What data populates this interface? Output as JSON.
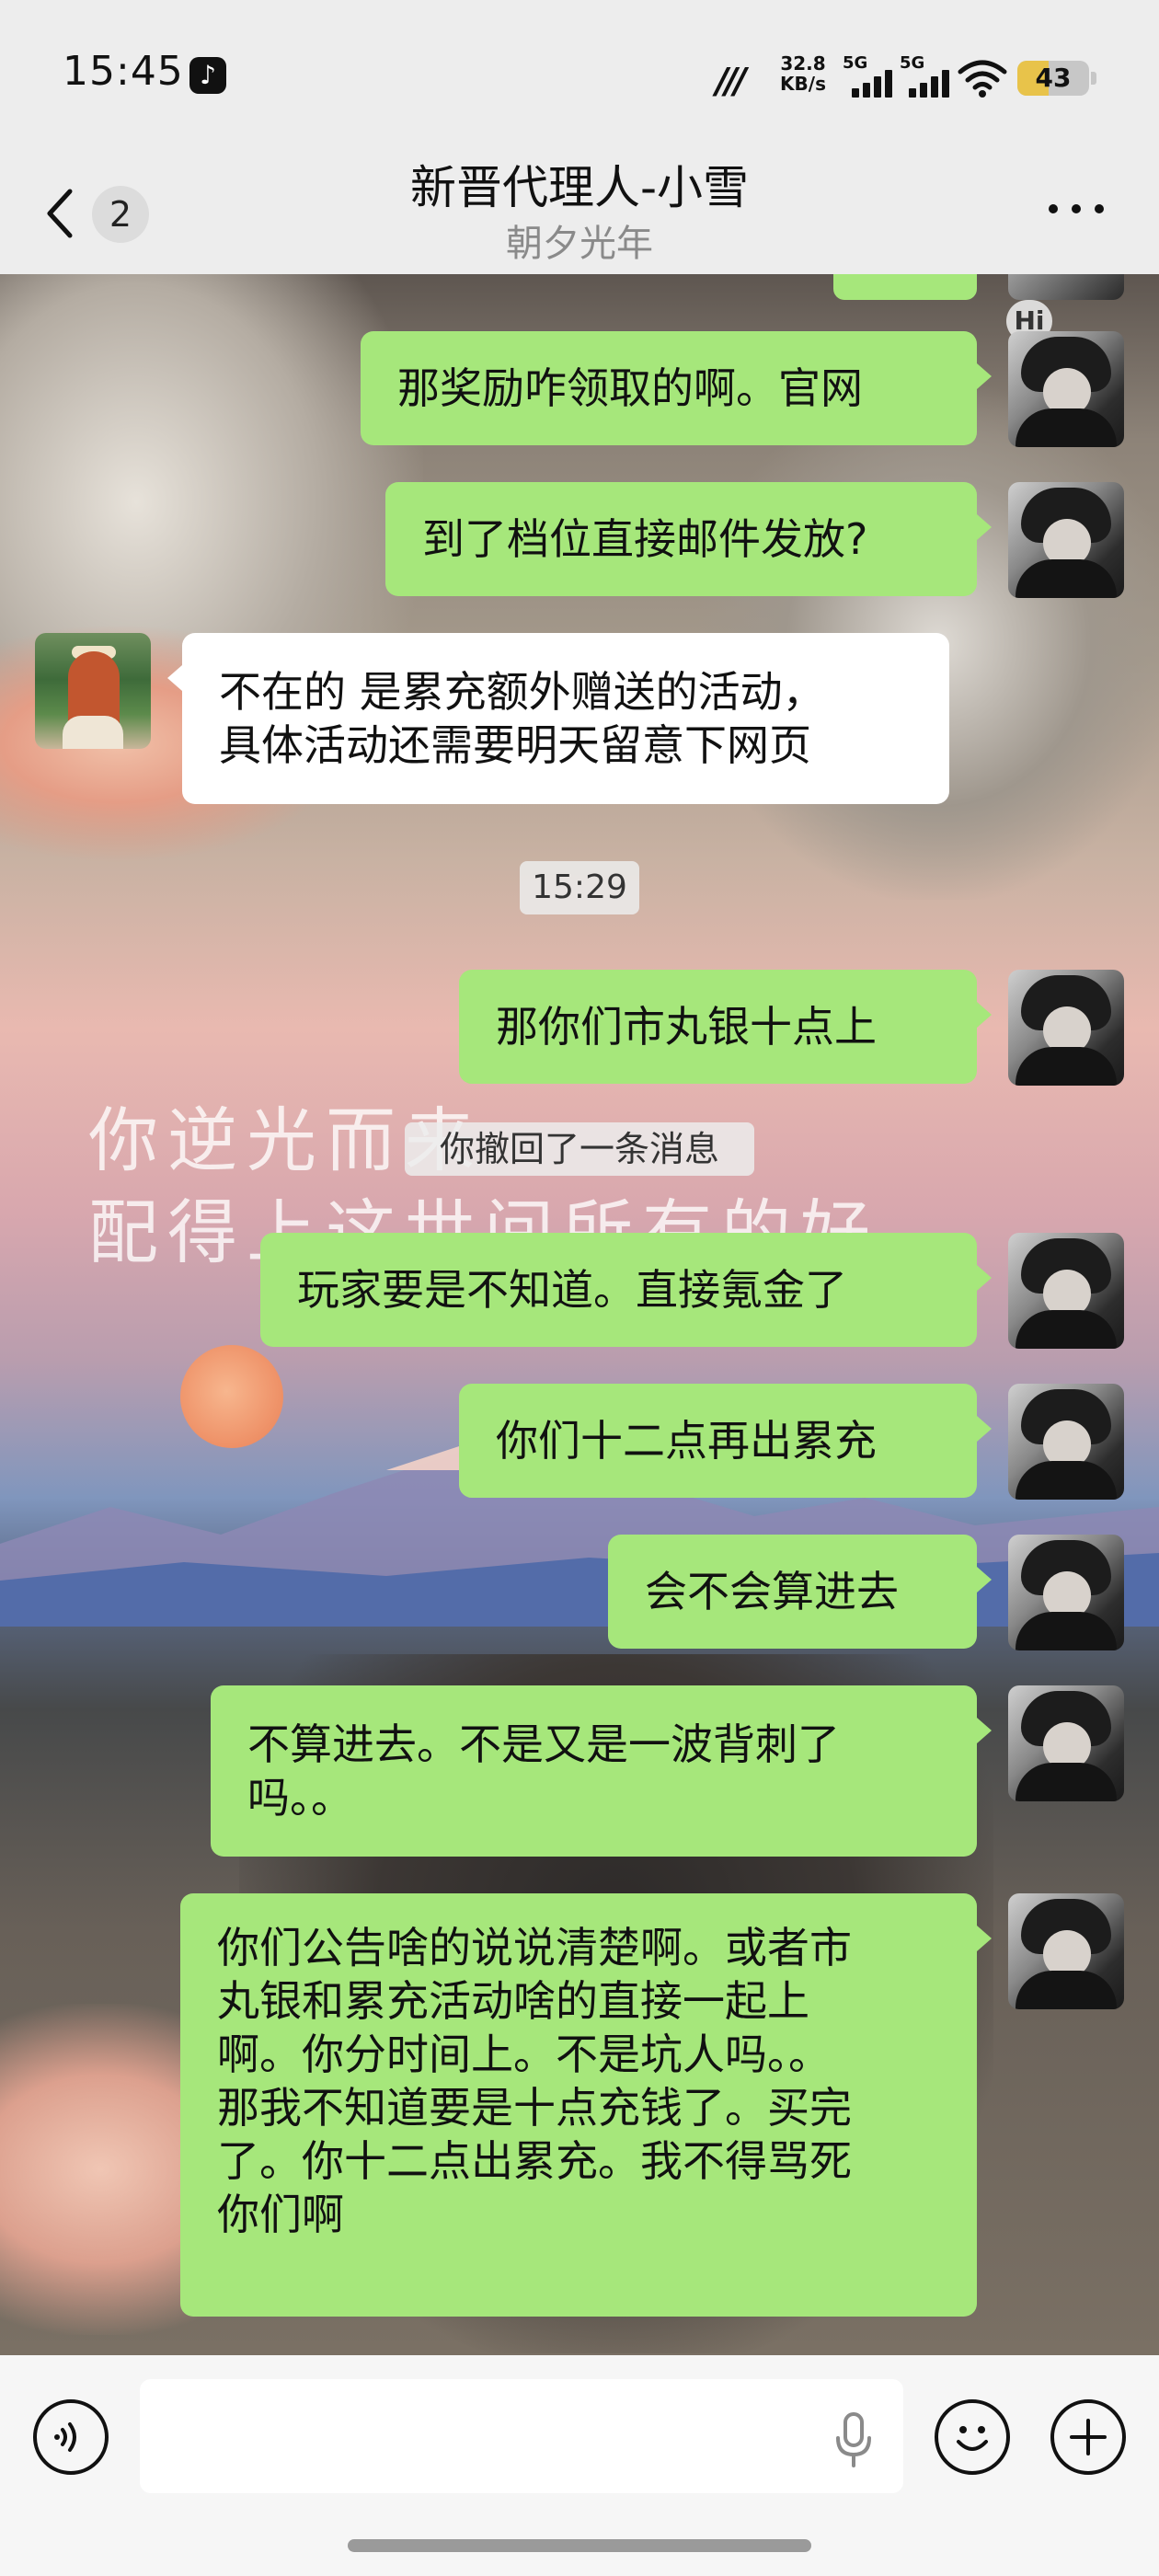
{
  "status_bar": {
    "time": "15:45",
    "app_badge_icon": "tiktok-icon",
    "network_speed_value": "32.8",
    "network_speed_unit": "KB/s",
    "network_1_label": "5G",
    "network_2_label": "5G",
    "battery_level": "43"
  },
  "header": {
    "back_icon": "chevron-left-icon",
    "unread_count": "2",
    "title": "新晋代理人-小雪",
    "subtitle": "朝夕光年",
    "more_icon": "more-dots-icon"
  },
  "wallpaper": {
    "hi_tag": "Hi",
    "line1": "你逆光而来",
    "line2": "配得上这世间所有的好"
  },
  "messages": [
    {
      "from": "me",
      "text": "那奖励咋领取的啊。官网"
    },
    {
      "from": "me",
      "text": "到了档位直接邮件发放?"
    },
    {
      "from": "agent",
      "text": "不在的 是累充额外赠送的活动，\n具体活动还需要明天留意下网页"
    },
    {
      "from": "me",
      "text": "那你们市丸银十点上"
    },
    {
      "from": "me",
      "text": "玩家要是不知道。直接氪金了"
    },
    {
      "from": "me",
      "text": "你们十二点再出累充"
    },
    {
      "from": "me",
      "text": "会不会算进去"
    },
    {
      "from": "me",
      "text": "不算进去。不是又是一波背刺了\n吗。。"
    },
    {
      "from": "me",
      "text": "你们公告啥的说说清楚啊。或者市\n丸银和累充活动啥的直接一起上\n啊。你分时间上。不是坑人吗。。\n那我不知道要是十点充钱了。买完\n了。你十二点出累充。我不得骂死\n你们啊"
    }
  ],
  "timestamp": "15:29",
  "system_notice": "你撤回了一条消息",
  "input_bar": {
    "voice_icon": "voice-icon",
    "placeholder": "",
    "mic_icon": "microphone-icon",
    "emoji_icon": "emoji-icon",
    "plus_icon": "plus-icon"
  }
}
